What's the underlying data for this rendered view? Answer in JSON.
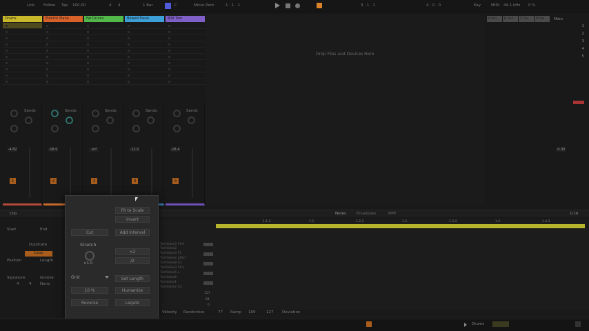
{
  "topbar": {
    "link": "Link",
    "follow": "Follow",
    "tap": "Tap",
    "tempo": "100.00",
    "sig_num": "4",
    "sig_den": "4",
    "quant": "1 Bar",
    "key": "C",
    "scale": "Minor Pent.",
    "position": "1 . 1 . 1",
    "pos2": "3 . 1 . 1",
    "pos3": "4 . 0 . 0",
    "key_lbl": "Key",
    "midi_lbl": "MIDI",
    "sample_rate": "44.1 kHz",
    "cpu": "0 %"
  },
  "tracks": [
    {
      "name": "Drums",
      "color": "#c8b82a",
      "num": "1",
      "vol": "-4.82"
    },
    {
      "name": "Electric Piano",
      "color": "#d8612a",
      "num": "2",
      "vol": "-18.0"
    },
    {
      "name": "Fat Drums",
      "color": "#53b84a",
      "num": "3",
      "vol": "-inf"
    },
    {
      "name": "Bowed Piano",
      "color": "#3d9fd8",
      "num": "4",
      "vol": "-12.0"
    },
    {
      "name": "808 Tom",
      "color": "#7f5fc8",
      "num": "5",
      "vol": "-18.4"
    }
  ],
  "sends_label": "Sends",
  "returns": [
    {
      "name": "A Rev"
    },
    {
      "name": "B Hall"
    },
    {
      "name": "C Del"
    },
    {
      "name": "D Del"
    }
  ],
  "main": {
    "name": "Main",
    "scenes": [
      "1",
      "2",
      "3",
      "4",
      "5"
    ],
    "vol": "-0.30"
  },
  "drop_text": "Drop Files and Devices Here",
  "clip": {
    "header": "Clip",
    "start": "Start",
    "end": "End",
    "duplicate": "Duplicate",
    "loop": "Loop",
    "position": "Position",
    "length": "Length",
    "signature": "Signature",
    "groove": "Groove",
    "groove_val": "None",
    "sig_num": "4",
    "sig_den": "4"
  },
  "editor": {
    "tabs": [
      "Notes",
      "Envelopes",
      "MPE"
    ],
    "page": "1/16",
    "ruler": [
      "1.1.2",
      "1.2",
      "1.2.2",
      "1.3",
      "1.3.2",
      "1.4",
      "1.4.2"
    ],
    "note_names": [
      "TomValve3 F#4",
      "TomValve2",
      "TomValve3 F3",
      "TomValve2 pDist",
      "TomValve8 G1",
      "TomValve3 F#3",
      "TomValve5 x",
      "TomValve6",
      "TomValve1",
      "TomValve2 G1"
    ],
    "velocity_lbl": "Velocity",
    "randomize_lbl": "Randomize",
    "vel_val": "77",
    "ramp_lbl": "Ramp",
    "ramp_val": "100",
    "ramp_max": "127",
    "deviation_lbl": "Deviation",
    "scale_127": "127",
    "scale_64": "64",
    "scale_0": "0"
  },
  "context_menu": {
    "fit_to_scale": "Fit to Scale",
    "invert": "Invert",
    "cut": "Cut",
    "add_interval": "Add Interval",
    "stretch": "Stretch",
    "x2": "×2",
    "div2": "/2",
    "stretch_val": "×1.0",
    "grid": "Grid",
    "set_length": "Set Length",
    "percent": "10 %",
    "humanize": "Humanize",
    "reverse": "Reverse",
    "legato": "Legato"
  },
  "statusbar": {
    "track": "Drums"
  }
}
